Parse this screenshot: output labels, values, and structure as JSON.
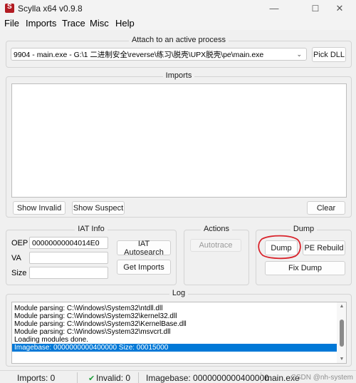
{
  "window": {
    "title": "Scylla x64 v0.9.8"
  },
  "menu": [
    "File",
    "Imports",
    "Trace",
    "Misc",
    "Help"
  ],
  "attach": {
    "label": "Attach to an active process",
    "process": "9904 - main.exe - G:\\1 二进制安全\\reverse\\练习\\脱壳\\UPX脱壳\\pe\\main.exe",
    "pick_dll": "Pick DLL"
  },
  "imports": {
    "label": "Imports",
    "show_invalid": "Show Invalid",
    "show_suspect": "Show Suspect",
    "clear": "Clear"
  },
  "iat": {
    "label": "IAT Info",
    "oep_label": "OEP",
    "oep_value": "00000000004014E0",
    "va_label": "VA",
    "va_value": "",
    "size_label": "Size",
    "size_value": "",
    "autosearch": "IAT Autosearch",
    "get_imports": "Get Imports"
  },
  "actions": {
    "label": "Actions",
    "autotrace": "Autotrace"
  },
  "dump": {
    "label": "Dump",
    "dump_btn": "Dump",
    "pe_rebuild": "PE Rebuild",
    "fix_dump": "Fix Dump"
  },
  "log": {
    "label": "Log",
    "lines": [
      "Module parsing: C:\\Windows\\System32\\ntdll.dll",
      "Module parsing: C:\\Windows\\System32\\kernel32.dll",
      "Module parsing: C:\\Windows\\System32\\KernelBase.dll",
      "Module parsing: C:\\Windows\\System32\\msvcrt.dll",
      "Loading modules done.",
      "Imagebase: 0000000000400000 Size: 00015000"
    ]
  },
  "status": {
    "imports": "Imports: 0",
    "invalid": "Invalid: 0",
    "imagebase": "Imagebase: 0000000000400000",
    "module": "main.exe",
    "watermark": "CSDN @nh-system"
  },
  "colors": {
    "selection": "#0078d7",
    "highlight_circle": "#d9232b",
    "check": "#1e9e3a"
  }
}
